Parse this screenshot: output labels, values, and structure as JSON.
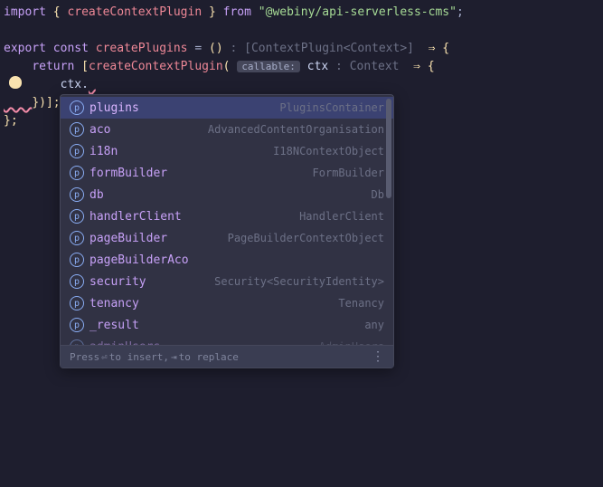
{
  "code": {
    "line1": {
      "import": "import",
      "lbrace": "{",
      "fn": "createContextPlugin",
      "rbrace": "}",
      "from": "from",
      "pkg": "\"@webiny/api-serverless-cms\"",
      "semi": ";"
    },
    "line3": {
      "export": "export",
      "const": "const",
      "fn": "createPlugins",
      "eq": "=",
      "lparen": "(",
      "rparen": ")",
      "hint": " : [ContextPlugin<Context>] ",
      "arrow": "⇒",
      "lbrace": "{"
    },
    "line4": {
      "return": "return",
      "lbracket": "[",
      "fn": "createContextPlugin",
      "lparen": "(",
      "pill": "callable:",
      "ctx": "ctx",
      "hint": " : Context ",
      "arrow": "⇒",
      "lbrace": "{"
    },
    "line5": {
      "ctx": "ctx",
      "dot": "."
    },
    "line6": {
      "close": "})];"
    },
    "line7": {
      "close": "};"
    }
  },
  "autocomplete": {
    "icon_letter": "p",
    "items": [
      {
        "label": "plugins",
        "type": "PluginsContainer",
        "selected": true
      },
      {
        "label": "aco",
        "type": "AdvancedContentOrganisation"
      },
      {
        "label": "i18n",
        "type": "I18NContextObject"
      },
      {
        "label": "formBuilder",
        "type": "FormBuilder"
      },
      {
        "label": "db",
        "type": "Db"
      },
      {
        "label": "handlerClient",
        "type": "HandlerClient"
      },
      {
        "label": "pageBuilder",
        "type": "PageBuilderContextObject"
      },
      {
        "label": "pageBuilderAco",
        "type": ""
      },
      {
        "label": "security",
        "type": "Security<SecurityIdentity>"
      },
      {
        "label": "tenancy",
        "type": "Tenancy"
      },
      {
        "label": "_result",
        "type": "any"
      },
      {
        "label": "adminUsers",
        "type": "AdminUsers",
        "faded": true
      }
    ],
    "footer": {
      "press": "Press ",
      "enter": "⏎",
      "insert": " to insert, ",
      "tab": "⇥",
      "replace": " to replace"
    }
  }
}
